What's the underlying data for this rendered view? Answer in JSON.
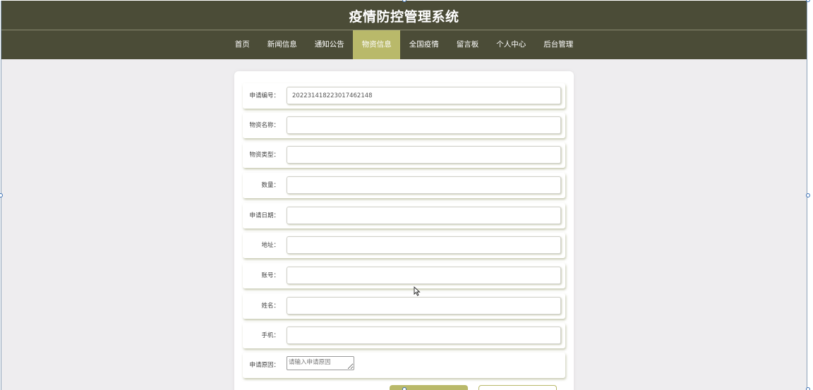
{
  "header": {
    "title": "疫情防控管理系统"
  },
  "nav": {
    "items": [
      {
        "label": "首页"
      },
      {
        "label": "新闻信息"
      },
      {
        "label": "通知公告"
      },
      {
        "label": "物资信息",
        "active": true
      },
      {
        "label": "全国疫情"
      },
      {
        "label": "留言板"
      },
      {
        "label": "个人中心"
      },
      {
        "label": "后台管理"
      }
    ]
  },
  "form": {
    "fields": [
      {
        "label": "申请编号：",
        "value": "20223141822301​7462148",
        "placeholder": ""
      },
      {
        "label": "物资名称：",
        "value": "",
        "placeholder": ""
      },
      {
        "label": "物资类型：",
        "value": "",
        "placeholder": ""
      },
      {
        "label": "数量：",
        "value": "",
        "placeholder": ""
      },
      {
        "label": "申请日期：",
        "value": "",
        "placeholder": ""
      },
      {
        "label": "地址：",
        "value": "",
        "placeholder": ""
      },
      {
        "label": "账号：",
        "value": "",
        "placeholder": ""
      },
      {
        "label": "姓名：",
        "value": "",
        "placeholder": ""
      },
      {
        "label": "手机：",
        "value": "",
        "placeholder": ""
      }
    ],
    "reason": {
      "label": "申请原因：",
      "placeholder": "请输入申请原因"
    }
  },
  "colors": {
    "header_bg": "#4b4c37",
    "accent": "#b9b96a",
    "page_bg": "#eeedef"
  }
}
